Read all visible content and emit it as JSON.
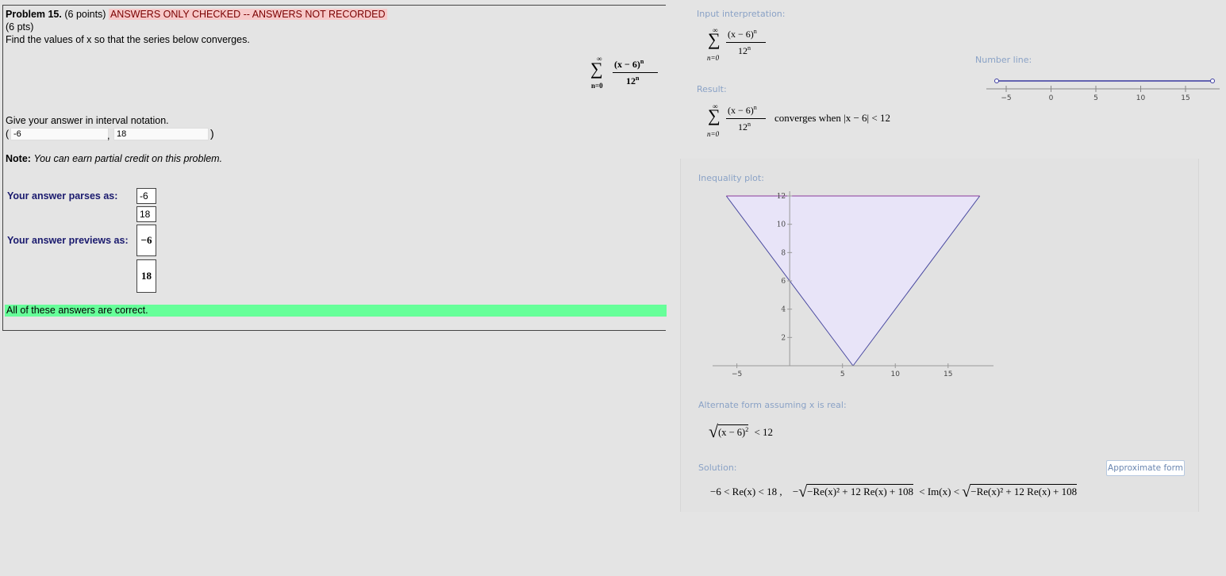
{
  "problem": {
    "heading": "Problem 15.",
    "points": "(6 points)",
    "status_banner": "ANSWERS ONLY CHECKED -- ANSWERS NOT RECORDED",
    "pts_line": "(6 pts)",
    "prompt": "Find the values of x so that the series below converges.",
    "series": {
      "sum_top": "∞",
      "sum_bottom": "n=0",
      "numerator": "(x − 6)",
      "num_exp": "n",
      "denominator": "12",
      "den_exp": "n"
    },
    "interval_prompt": "Give your answer in interval notation.",
    "open_paren": "(",
    "left_value": "-6",
    "comma": ",",
    "right_value": "18",
    "close_paren": ")",
    "note_label": "Note:",
    "note_text": "You can earn partial credit on this problem."
  },
  "results": {
    "parses_label": "Your answer parses as:",
    "parse_values": [
      "-6",
      "18"
    ],
    "previews_label": "Your answer previews as:",
    "preview_values": [
      "−6",
      "18"
    ],
    "correct_message": "All of these answers are correct."
  },
  "wolfram": {
    "input_label": "Input interpretation:",
    "result_label": "Result:",
    "result_text": "converges when |x − 6| < 12",
    "number_line_label": "Number line:",
    "number_line_ticks": [
      "−5",
      "0",
      "5",
      "10",
      "15"
    ],
    "inequality_label": "Inequality plot:",
    "alternate_label": "Alternate form assuming x is real:",
    "alternate_expr": "(x − 6)",
    "alternate_exp": "2",
    "alternate_rhs": "< 12",
    "solution_label": "Solution:",
    "approx_button": "Approximate form",
    "solution_part1": "−6 < Re(x) < 18 ,",
    "solution_minus": "−",
    "solution_radicand": "−Re(x)² + 12 Re(x) + 108",
    "solution_mid": "< Im(x) <",
    "solution_radicand2": "−Re(x)² + 12 Re(x) + 108"
  },
  "chart_data": {
    "type": "area",
    "x_ticks": [
      "−5",
      "5",
      "10",
      "15"
    ],
    "y_ticks": [
      "2",
      "4",
      "6",
      "8",
      "10",
      "12"
    ],
    "x": [
      -6,
      6,
      18
    ],
    "y": [
      12,
      0,
      12
    ],
    "xlim": [
      -7,
      19
    ],
    "ylim": [
      0,
      12
    ],
    "fill_color": "#e8e4f8",
    "line_color": "#4a4aa0"
  }
}
